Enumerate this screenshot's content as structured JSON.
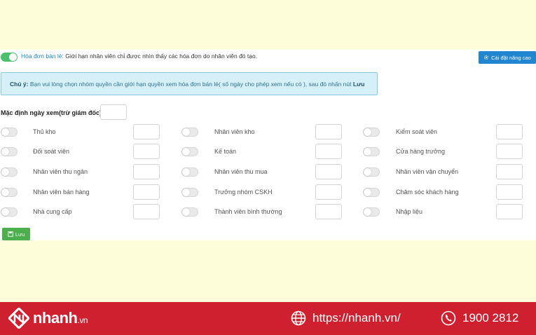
{
  "header": {
    "enabled": true,
    "label": "Hóa đơn bán lẻ:",
    "description": "Giới hạn nhân viên chỉ được nhìn thấy các hóa đơn do nhân viên đó tạo.",
    "advanced_button": "Cài đặt nâng cao"
  },
  "note": {
    "prefix": "Chú ý:",
    "text": "Bạn vui lòng chọn nhóm quyền cần giới hạn quyền xem hóa đơn bán lẻ( số ngày cho phép xem nếu có ), sau đó nhấn nút",
    "action": "Lưu"
  },
  "default_days": {
    "label": "Mặc định ngày xem(trừ giám đốc)",
    "value": ""
  },
  "roles": [
    [
      {
        "name": "Thủ kho",
        "enabled": false,
        "days": ""
      },
      {
        "name": "Đối soát viên",
        "enabled": false,
        "days": ""
      },
      {
        "name": "Nhân viên thu ngân",
        "enabled": false,
        "days": ""
      },
      {
        "name": "Nhân viên bán hàng",
        "enabled": false,
        "days": ""
      },
      {
        "name": "Nhà cung cấp",
        "enabled": false,
        "days": ""
      }
    ],
    [
      {
        "name": "Nhân viên kho",
        "enabled": false,
        "days": ""
      },
      {
        "name": "Kế toán",
        "enabled": false,
        "days": ""
      },
      {
        "name": "Nhân viên thu mua",
        "enabled": false,
        "days": ""
      },
      {
        "name": "Trưởng nhóm CSKH",
        "enabled": false,
        "days": ""
      },
      {
        "name": "Thành viên bình thường",
        "enabled": false,
        "days": ""
      }
    ],
    [
      {
        "name": "Kiểm soát viên",
        "enabled": false,
        "days": ""
      },
      {
        "name": "Cửa hàng trưởng",
        "enabled": false,
        "days": ""
      },
      {
        "name": "Nhân viên vận chuyển",
        "enabled": false,
        "days": ""
      },
      {
        "name": "Chăm sóc khách hàng",
        "enabled": false,
        "days": ""
      },
      {
        "name": "Nhập liệu",
        "enabled": false,
        "days": ""
      }
    ]
  ],
  "save_button": "Lưu",
  "footer": {
    "brand": "nhanh",
    "brand_tld": ".vn",
    "website": "https://nhanh.vn/",
    "phone": "1900 2812"
  },
  "colors": {
    "toggle_on": "#4bbf6b",
    "primary_button": "#2185d0",
    "save_button": "#4cae4c",
    "footer_bg": "#cf2030",
    "note_bg": "#d5f0f8"
  }
}
